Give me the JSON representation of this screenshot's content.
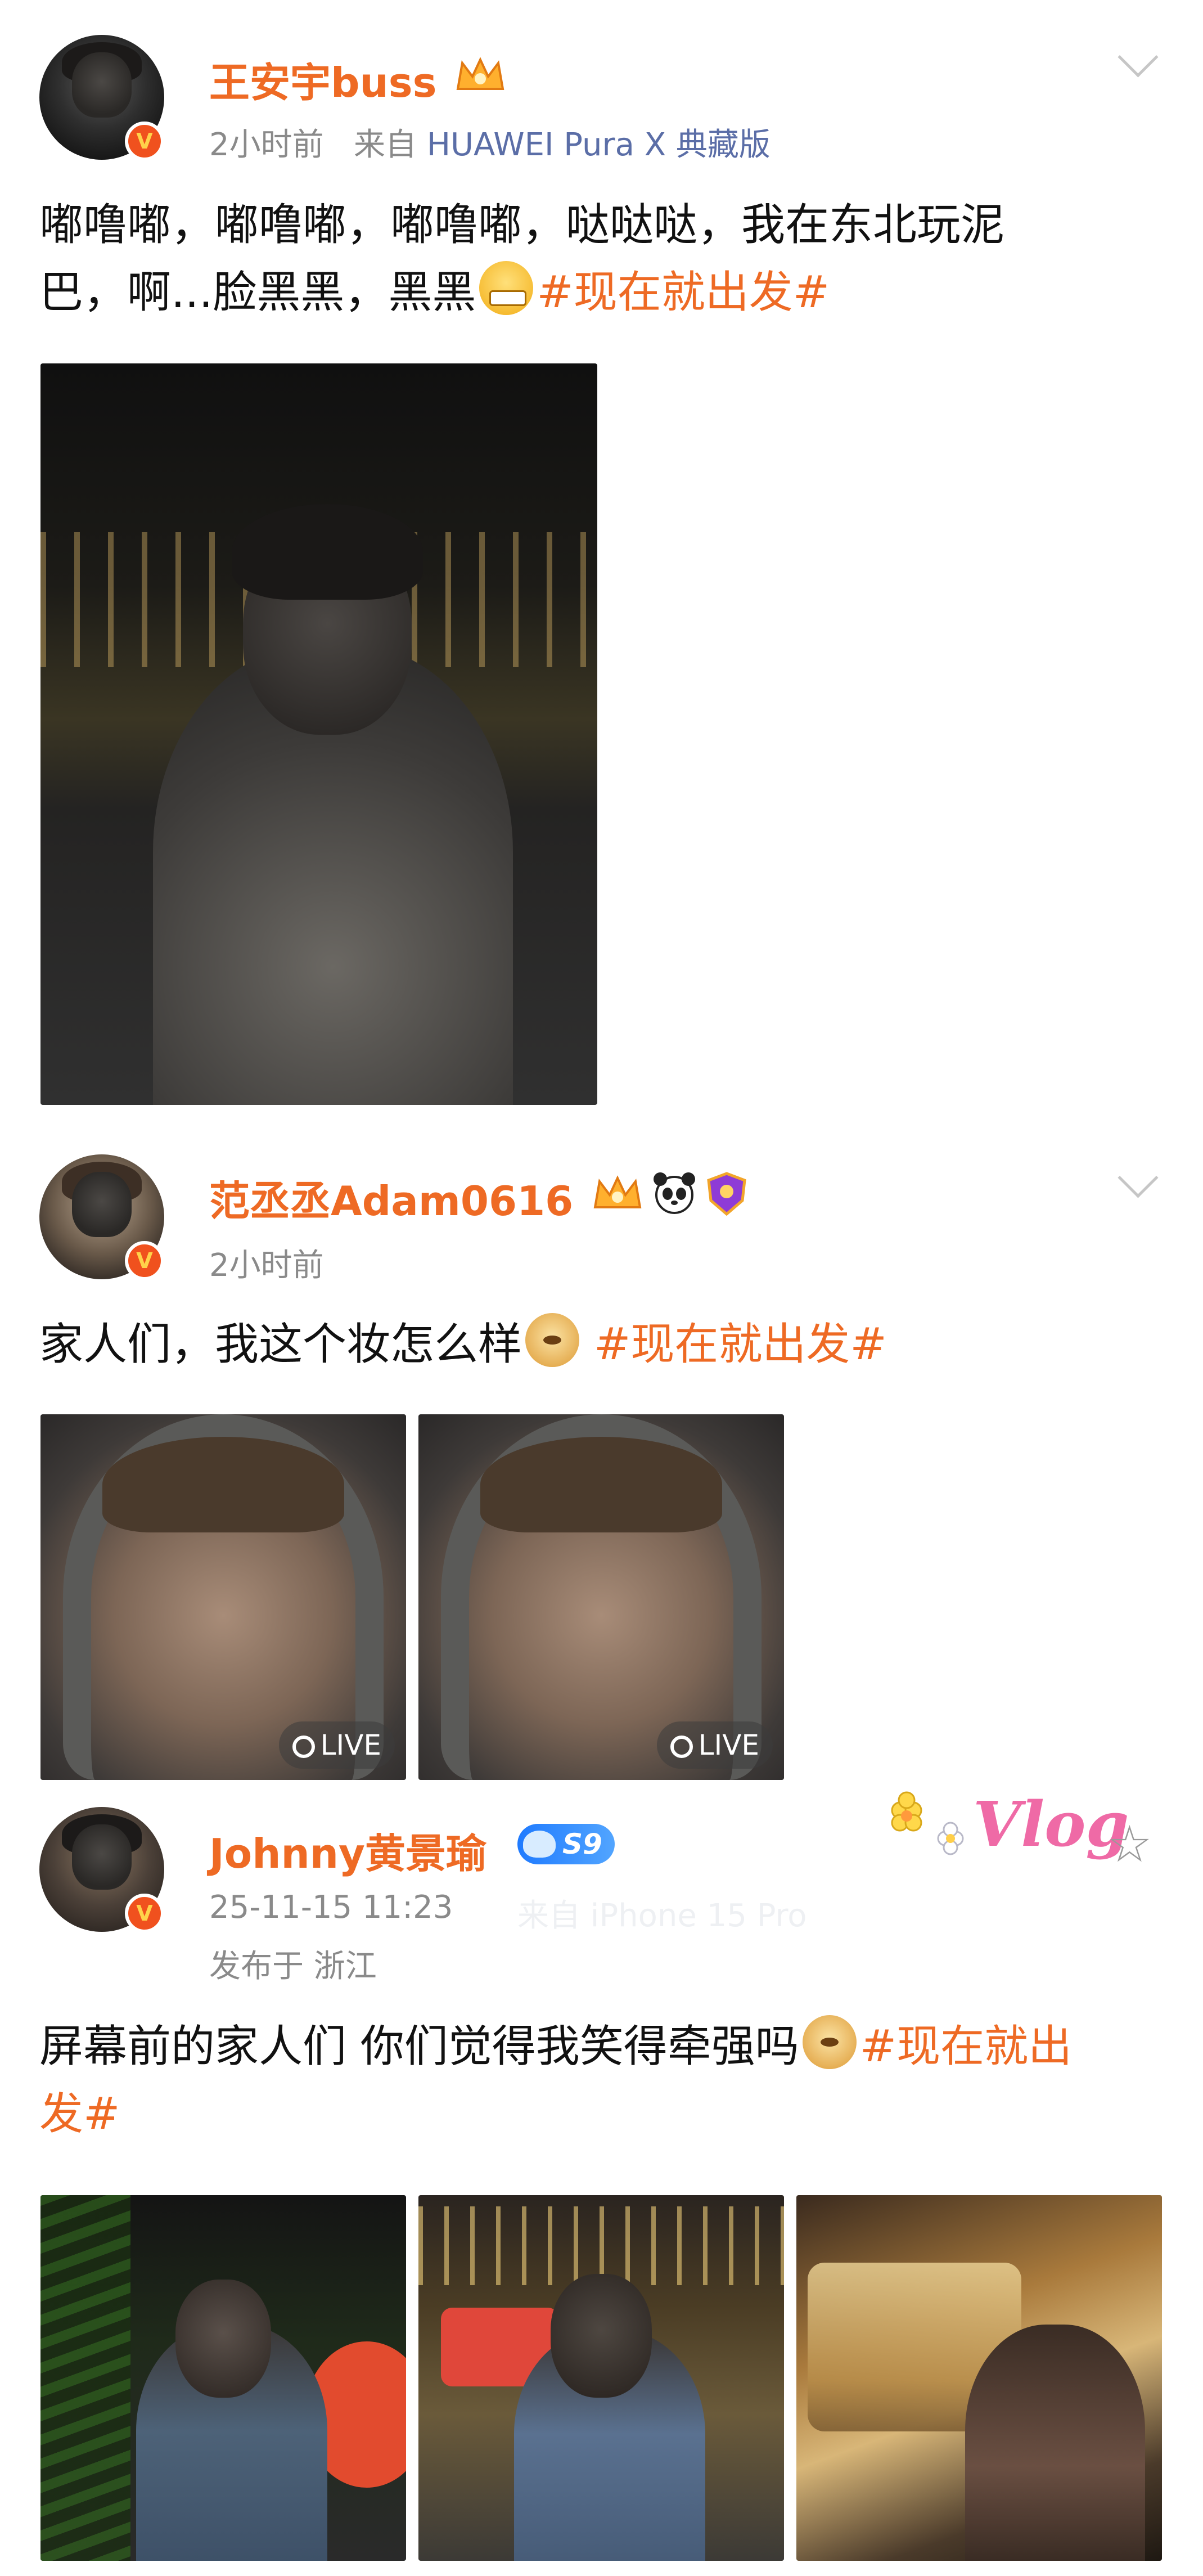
{
  "posts": [
    {
      "author": "王安宇buss",
      "time": "2小时前",
      "source_prefix": "来自",
      "source": "HUAWEI Pura X 典藏版",
      "text_lines": [
        "嘟噜嘟，嘟噜嘟，嘟噜嘟，哒哒哒，我在东北玩泥",
        "巴，啊...脸黑黑，黑黑"
      ],
      "hashtag": "#现在就出发#",
      "emoji": "grinning-face"
    },
    {
      "author": "范丞丞Adam0616",
      "time": "2小时前",
      "text": "家人们，我这个妆怎么样",
      "hashtag": "#现在就出发#",
      "emoji": "doge",
      "live_label": "LIVE"
    },
    {
      "author": "Johnny黄景瑜",
      "fan_level": "S9",
      "time": "25-11-15 11:23",
      "location": "发布于 浙江",
      "faint_text": "来自 iPhone 15 Pro",
      "text_line1": "屏幕前的家人们 你们觉得我笑得牵强吗",
      "hashtag_part1": "#现在就出",
      "hashtag_part2": "发#",
      "emoji": "doge",
      "vlog_sticker": "Vlog"
    }
  ],
  "colors": {
    "accent": "#ee6a24",
    "meta": "#8a8a8a",
    "source": "#5b6ea7"
  }
}
